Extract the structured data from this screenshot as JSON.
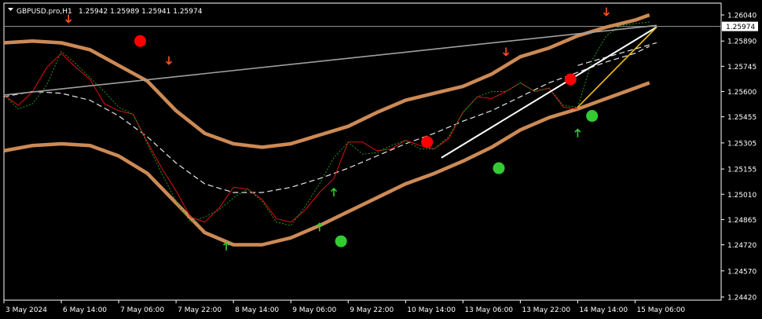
{
  "window": {
    "symbol": "GBPUSD.pro,H1",
    "ohlc": "1.25942 1.25989 1.25941 1.25974",
    "collapse_icon": "triangle-down-icon"
  },
  "colors": {
    "background": "#000000",
    "axis": "#ffffff",
    "band": "#cd8a55",
    "price": "#e01010",
    "signal": "#1f9a1f",
    "mid": "#e6e6e6",
    "trend": "#a0a0a0",
    "sell_dot": "#ff0000",
    "buy_dot": "#33cc33",
    "arrow_up": "#33cc33",
    "arrow_down": "#ff5522",
    "channel_line": "#ffffff",
    "yellow_line": "#f0c000"
  },
  "chart_data": {
    "type": "line",
    "x_range": [
      0,
      100
    ],
    "ylim": [
      1.2442,
      1.2604
    ],
    "y_ticks": [
      "1.26040",
      "1.25890",
      "1.25745",
      "1.25600",
      "1.25455",
      "1.25305",
      "1.25155",
      "1.25010",
      "1.24865",
      "1.24720",
      "1.24570",
      "1.24420"
    ],
    "y_tick_values": [
      1.2604,
      1.2589,
      1.25745,
      1.256,
      1.25455,
      1.25305,
      1.25155,
      1.2501,
      1.24865,
      1.2472,
      1.2457,
      1.2442
    ],
    "x_ticks": [
      "3 May 2024",
      "6 May 14:00",
      "7 May 06:00",
      "7 May 22:00",
      "8 May 14:00",
      "9 May 06:00",
      "9 May 22:00",
      "10 May 14:00",
      "13 May 06:00",
      "13 May 22:00",
      "14 May 14:00",
      "15 May 06:00"
    ],
    "x_tick_positions": [
      0,
      8,
      16,
      24,
      32,
      40,
      48,
      56,
      64,
      72,
      80,
      88
    ],
    "current_price": "1.25974",
    "current_price_value": 1.25974,
    "series": [
      {
        "role": "upper_band",
        "x": [
          0,
          4,
          8,
          12,
          16,
          20,
          24,
          28,
          32,
          36,
          40,
          44,
          48,
          52,
          56,
          60,
          64,
          68,
          72,
          76,
          80,
          84,
          88,
          90
        ],
        "y": [
          1.2588,
          1.2589,
          1.2588,
          1.2584,
          1.2575,
          1.2566,
          1.2549,
          1.2536,
          1.253,
          1.2528,
          1.253,
          1.2535,
          1.254,
          1.2548,
          1.2555,
          1.2559,
          1.2563,
          1.257,
          1.258,
          1.2585,
          1.2592,
          1.2597,
          1.2601,
          1.2604
        ]
      },
      {
        "role": "lower_band",
        "x": [
          0,
          4,
          8,
          12,
          16,
          20,
          24,
          28,
          32,
          36,
          40,
          44,
          48,
          52,
          56,
          60,
          64,
          68,
          72,
          76,
          80,
          84,
          88,
          90
        ],
        "y": [
          1.2526,
          1.2529,
          1.253,
          1.2529,
          1.2523,
          1.2513,
          1.2496,
          1.2479,
          1.2472,
          1.2472,
          1.2476,
          1.2483,
          1.2491,
          1.2499,
          1.2507,
          1.2513,
          1.252,
          1.2528,
          1.2538,
          1.2545,
          1.255,
          1.2556,
          1.2562,
          1.2565
        ]
      },
      {
        "role": "midline",
        "x": [
          0,
          4,
          8,
          12,
          16,
          20,
          24,
          28,
          32,
          36,
          40,
          44,
          48,
          52,
          56,
          60,
          64,
          68,
          72,
          76,
          80,
          84,
          88,
          90
        ],
        "y": [
          1.2557,
          1.256,
          1.2559,
          1.2555,
          1.2546,
          1.2534,
          1.2519,
          1.2507,
          1.2502,
          1.2502,
          1.2505,
          1.251,
          1.2516,
          1.2523,
          1.253,
          1.2536,
          1.2543,
          1.2549,
          1.2557,
          1.2565,
          1.2571,
          1.2577,
          1.2582,
          1.2586
        ]
      },
      {
        "role": "price",
        "x": [
          0,
          2,
          4,
          6,
          8,
          10,
          12,
          14,
          16,
          18,
          20,
          22,
          24,
          26,
          28,
          30,
          32,
          34,
          36,
          38,
          40,
          42,
          44,
          46,
          48,
          50,
          52,
          54,
          56,
          58,
          60,
          62,
          64,
          66,
          68,
          70,
          72,
          74,
          76,
          78,
          80
        ],
        "y": [
          1.2558,
          1.2552,
          1.256,
          1.2574,
          1.2582,
          1.2574,
          1.2567,
          1.2553,
          1.2549,
          1.2547,
          1.2531,
          1.2516,
          1.2503,
          1.2488,
          1.2485,
          1.2493,
          1.2505,
          1.2504,
          1.2498,
          1.2487,
          1.2485,
          1.2492,
          1.2502,
          1.251,
          1.2531,
          1.2531,
          1.2526,
          1.2527,
          1.2532,
          1.2529,
          1.2527,
          1.2533,
          1.2548,
          1.2557,
          1.2556,
          1.256,
          1.2565,
          1.256,
          1.2562,
          1.2551,
          1.255
        ]
      },
      {
        "role": "signal",
        "x": [
          0,
          2,
          4,
          6,
          8,
          10,
          12,
          14,
          16,
          18,
          20,
          22,
          24,
          26,
          28,
          30,
          32,
          34,
          36,
          38,
          40,
          42,
          44,
          46,
          48,
          50,
          52,
          54,
          56,
          58,
          60,
          62,
          64,
          66,
          68,
          70,
          72,
          74,
          76,
          78,
          80,
          82,
          84,
          86,
          88,
          90
        ],
        "y": [
          1.2558,
          1.255,
          1.2553,
          1.2564,
          1.2583,
          1.2576,
          1.2568,
          1.256,
          1.2551,
          1.2547,
          1.253,
          1.2513,
          1.2497,
          1.2485,
          1.2488,
          1.2492,
          1.2499,
          1.2504,
          1.2497,
          1.2485,
          1.2483,
          1.2494,
          1.2507,
          1.2522,
          1.2531,
          1.2524,
          1.2525,
          1.2529,
          1.2532,
          1.2527,
          1.2527,
          1.2534,
          1.2548,
          1.2557,
          1.256,
          1.256,
          1.2565,
          1.256,
          1.2562,
          1.2552,
          1.2551,
          1.2578,
          1.2592,
          1.2598,
          1.2599,
          1.26
        ]
      }
    ],
    "lines": [
      {
        "role": "trend",
        "x": [
          0,
          91
        ],
        "y": [
          1.2558,
          1.2598
        ]
      },
      {
        "role": "channel",
        "x": [
          61,
          91
        ],
        "y": [
          1.2522,
          1.2597
        ]
      },
      {
        "role": "yellow",
        "x": [
          80,
          91
        ],
        "y": [
          1.2551,
          1.2597
        ]
      },
      {
        "role": "mid_ext",
        "x": [
          80,
          91
        ],
        "y": [
          1.2575,
          1.2588
        ]
      }
    ],
    "sell_dots": [
      {
        "x": 19,
        "y": 1.2589
      },
      {
        "x": 59,
        "y": 1.2531
      },
      {
        "x": 79,
        "y": 1.2567
      }
    ],
    "buy_dots": [
      {
        "x": 47,
        "y": 1.2474
      },
      {
        "x": 69,
        "y": 1.2516
      },
      {
        "x": 82,
        "y": 1.2546
      }
    ],
    "arrows_up": [
      {
        "x": 31,
        "y": 1.2471
      },
      {
        "x": 44,
        "y": 1.2482
      },
      {
        "x": 46,
        "y": 1.2502
      },
      {
        "x": 80,
        "y": 1.2536
      }
    ],
    "arrows_down": [
      {
        "x": 9,
        "y": 1.2602
      },
      {
        "x": 23,
        "y": 1.2578
      },
      {
        "x": 70,
        "y": 1.2583
      },
      {
        "x": 84,
        "y": 1.2606
      }
    ]
  }
}
